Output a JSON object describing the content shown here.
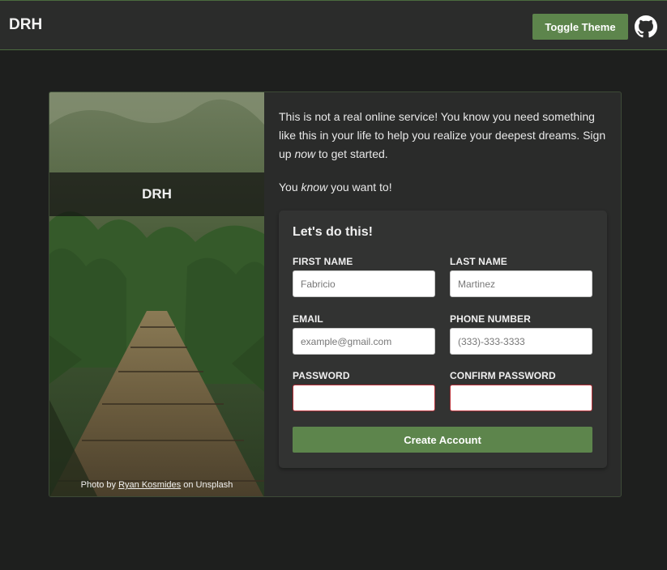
{
  "header": {
    "brand": "DRH",
    "toggle_label": "Toggle Theme",
    "github_icon": "github-icon"
  },
  "photo": {
    "banner_title": "DRH",
    "credit_prefix": "Photo by",
    "credit_author": "Ryan Kosmides",
    "credit_suffix": "on Unsplash"
  },
  "intro": {
    "line1_a": "This is not a real online service! You know you need something like this in your life to help you realize your deepest dreams. Sign up ",
    "line1_em": "now",
    "line1_b": " to get started.",
    "line2_a": "You ",
    "line2_em": "know",
    "line2_b": " you want to!"
  },
  "form": {
    "title": "Let's do this!",
    "first_name_label": "FIRST NAME",
    "first_name_placeholder": "Fabricio",
    "last_name_label": "LAST NAME",
    "last_name_placeholder": "Martinez",
    "email_label": "EMAIL",
    "email_placeholder": "example@gmail.com",
    "phone_label": "PHONE NUMBER",
    "phone_placeholder": "(333)-333-3333",
    "password_label": "PASSWORD",
    "confirm_password_label": "CONFIRM PASSWORD",
    "submit_label": "Create Account"
  },
  "colors": {
    "accent": "#5d854c",
    "background": "#1e1f1e",
    "card": "#2a2b2a",
    "panel": "#323332",
    "invalid_border": "#b8323a"
  }
}
